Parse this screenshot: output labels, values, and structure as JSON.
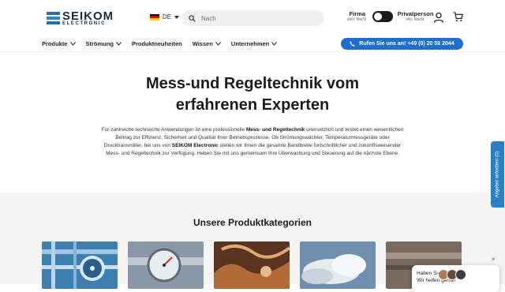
{
  "header": {
    "logo_text": "SEIKOM",
    "logo_sub": "ELECTRONIC",
    "language": "DE",
    "search_placeholder": "Nach",
    "toggle_left_label": "Firma",
    "toggle_left_sub": "exkl. MwSt.",
    "toggle_right_label": "Privatperson",
    "toggle_right_sub": "inkl. MwSt.",
    "call_label": "Rufen Sie uns an! +49 (0) 20 58 2044"
  },
  "nav": {
    "items": [
      {
        "label": "Produkte",
        "has_dropdown": true
      },
      {
        "label": "Strömung",
        "has_dropdown": true
      },
      {
        "label": "Produktneuheiten",
        "has_dropdown": false
      },
      {
        "label": "Wissen",
        "has_dropdown": true
      },
      {
        "label": "Unternehmen",
        "has_dropdown": true
      }
    ]
  },
  "hero": {
    "title_line1": "Mess-und Regeltechnik vom",
    "title_line2": "erfahrenen Experten",
    "text_1": "Für zahlreiche technische Anwendungen ist eine professionelle ",
    "text_bold_1": "Mess- und Regeltechnik",
    "text_2": " unersetzlich und leistet einen wesentlichen Beitrag zur Effizienz, Sicherheit und Qualität Ihrer Betriebsprozesse. Ob Strömungswächter, Temperaturmessgeräte oder Drucktransmitter, bei uns von ",
    "text_bold_2": "SEIKOM Electronic",
    "text_3": " stellen wir Ihnen die gesamte Bandbreite fortschrittlicher und zukunftsweisender Mess- und Regeltechnik zur Verfügung. Heben Sie mit uns gemeinsam Ihre Überwachung und Steuerung auf die nächste Ebene."
  },
  "categories": {
    "title": "Unsere Produktkategorien"
  },
  "side_tab": {
    "label": "Angebot anfordern (0)"
  },
  "chat": {
    "message": "Haben Sie Fragen? Wir helfen gerne!",
    "close": "×"
  },
  "colors": {
    "accent": "#1e6fd1",
    "brand": "#1f6fb2",
    "section_bg": "#f4f4f4"
  }
}
